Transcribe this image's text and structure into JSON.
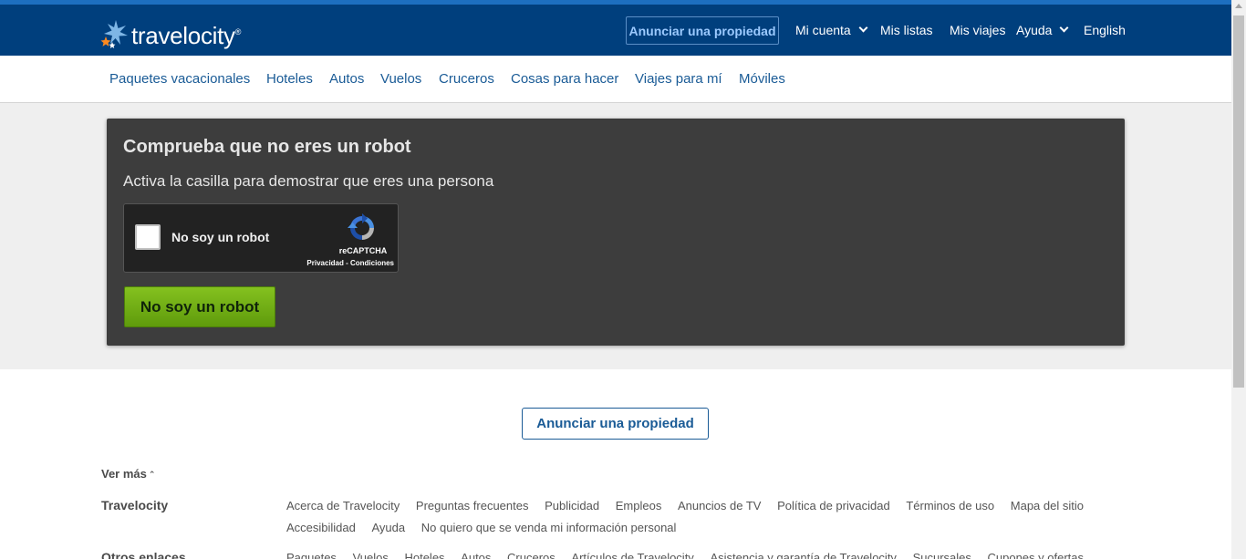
{
  "header": {
    "logo_text": "travelocity",
    "logo_tm": "®",
    "list_property": "Anunciar una propiedad",
    "my_account": "Mi cuenta",
    "my_lists": "Mis listas",
    "my_trips": "Mis viajes",
    "help": "Ayuda",
    "language": "English"
  },
  "subnav": {
    "items": [
      "Paquetes vacacionales",
      "Hoteles",
      "Autos",
      "Vuelos",
      "Cruceros",
      "Cosas para hacer",
      "Viajes para mí",
      "Móviles"
    ]
  },
  "captcha": {
    "title": "Comprueba que no eres un robot",
    "subtitle": "Activa la casilla para demostrar que eres una persona",
    "checkbox_label": "No soy un robot",
    "brand": "reCAPTCHA",
    "terms": "Privacidad - Condiciones",
    "button": "No soy un robot"
  },
  "footer": {
    "list_property": "Anunciar una propiedad",
    "see_more": "Ver más",
    "section1_title": "Travelocity",
    "section1_links": [
      "Acerca de Travelocity",
      "Preguntas frecuentes",
      "Publicidad",
      "Empleos",
      "Anuncios de TV",
      "Política de privacidad",
      "Términos de uso",
      "Mapa del sitio",
      "Accesibilidad",
      "Ayuda",
      "No quiero que se venda mi información personal"
    ],
    "section2_title": "Otros enlaces",
    "section2_links": [
      "Paquetes",
      "Vuelos",
      "Hoteles",
      "Autos",
      "Cruceros",
      "Artículos de Travelocity",
      "Asistencia y garantía de Travelocity",
      "Sucursales",
      "Cupones y ofertas"
    ]
  },
  "colors": {
    "header_bg": "#003f7d",
    "link_blue": "#1a5b96",
    "panel_bg": "#3d3d3d",
    "cta_green": "#6fae14"
  }
}
